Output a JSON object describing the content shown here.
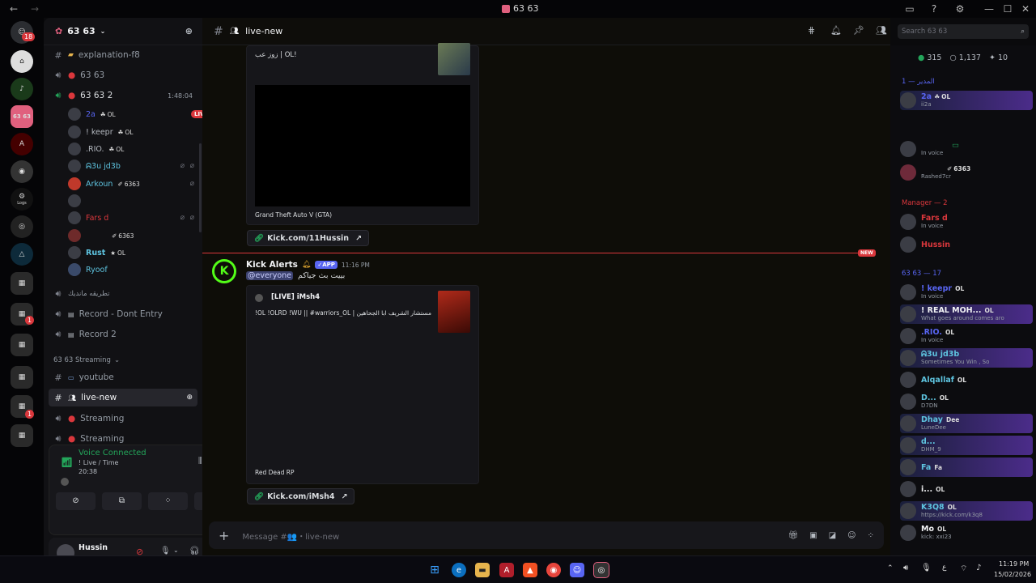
{
  "window": {
    "title": "63 63"
  },
  "rail": {
    "dm_badge": "18",
    "badges": [
      "1",
      "1",
      "1",
      "1"
    ],
    "labels": {
      "logs": "Logs",
      "server_icon": "63 63"
    }
  },
  "server": {
    "name": "63 63"
  },
  "channels": [
    {
      "name": "explanation-f8",
      "type": "text"
    },
    {
      "name": "63 63",
      "type": "voice"
    },
    {
      "name": "63 63 2",
      "type": "voice",
      "timer": "1:48:04"
    }
  ],
  "voice_users": [
    {
      "name": "2a",
      "tag": "OL",
      "live": "LIVE"
    },
    {
      "name": "! keepr",
      "tag": "OL"
    },
    {
      "name": ".RIO.",
      "tag": "OL"
    },
    {
      "name": "ᕱ3u jd3b",
      "tag": ""
    },
    {
      "name": "Arkoun",
      "tag": "6363"
    },
    {
      "name": "",
      "tag": ""
    },
    {
      "name": "Fars d",
      "tag": ""
    },
    {
      "name": "",
      "tag": "6363"
    },
    {
      "name": "Rust",
      "tag": "OL"
    },
    {
      "name": "Ryoof",
      "tag": ""
    }
  ],
  "channels2": [
    {
      "name": "تطريقه مانديك",
      "type": "voice"
    },
    {
      "name": "Record - Dont Entry",
      "type": "voice"
    },
    {
      "name": "Record 2",
      "type": "voice"
    }
  ],
  "category": "63 63 Streaming",
  "channels3": [
    {
      "name": "youtube",
      "type": "text"
    },
    {
      "name": "live-new",
      "type": "text",
      "active": true
    },
    {
      "name": "Streaming",
      "type": "voice"
    },
    {
      "name": "Streaming",
      "type": "voice"
    }
  ],
  "voice_panel": {
    "status": "Voice Connected",
    "channel": "! Live / Time",
    "time": "20:38"
  },
  "user": {
    "name": "Hussin",
    "status": "..."
  },
  "chat": {
    "channel": "live-new",
    "search_placeholder": "Search 63 63",
    "embed1": {
      "desc": "زوز عب | OL!",
      "game": "Grand Theft Auto V (GTA)",
      "link": "Kick.com/11Hussin"
    },
    "new_label": "NEW",
    "message": {
      "author": "Kick Alerts",
      "app": "APP",
      "time": "11:16 PM",
      "mention": "@everyone",
      "text": "بييت بث جياكم"
    },
    "embed2": {
      "title": "[LIVE] iMsh4",
      "desc": "!OL !OLRD !WU || #warriors_OL | مستشار الشريف ابا الجحاهين",
      "game": "Red Dead RP",
      "link": "Kick.com/iMsh4"
    },
    "composer_placeholder": "Message #👥・live-new"
  },
  "members": {
    "stats": {
      "online": "315",
      "members": "1,137",
      "other": "10"
    },
    "groups": [
      {
        "label": "المدير — 1",
        "items": [
          {
            "name": "2a",
            "sub": "ii2a",
            "tag": "OL"
          }
        ]
      },
      {
        "label": "",
        "items": [
          {
            "name": "",
            "sub": "In voice"
          },
          {
            "name": "",
            "sub": "Rashed7cr",
            "tag": "6363"
          }
        ]
      },
      {
        "label": "Manager — 2",
        "items": [
          {
            "name": "Fars d",
            "sub": "In voice"
          },
          {
            "name": "Hussin",
            "sub": ""
          }
        ]
      },
      {
        "label": "63 63 — 17",
        "items": [
          {
            "name": "! keepr",
            "sub": "In voice",
            "tag": "OL"
          },
          {
            "name": "! REAL MOH...",
            "sub": "What goes around comes aro",
            "tag": "OL"
          },
          {
            "name": ".RIO.",
            "sub": "In voice",
            "tag": "OL"
          },
          {
            "name": "ᕱ3u jd3b",
            "sub": "Sometimes You Win , So"
          },
          {
            "name": "Alqallaf",
            "sub": "",
            "tag": "OL"
          },
          {
            "name": "D...",
            "sub": "D7DN",
            "tag": "OL"
          },
          {
            "name": "Dhay",
            "sub": "LuneDee",
            "tag": "Dee"
          },
          {
            "name": "d...",
            "sub": "DHM_9"
          },
          {
            "name": "Fa",
            "sub": "",
            "tag": "Fa"
          },
          {
            "name": "i...",
            "sub": "",
            "tag": "OL"
          },
          {
            "name": "K3Q8",
            "sub": "https://kick.com/k3q8",
            "tag": "OL"
          },
          {
            "name": "Mo",
            "sub": "kick: xxi23",
            "tag": "OL"
          }
        ]
      }
    ]
  },
  "taskbar": {
    "time": "11:19 PM",
    "date": "15/02/2026",
    "lang": "ع"
  },
  "colors": {
    "accent": "#5865f2",
    "live": "#da373c",
    "online": "#23a55a",
    "kick": "#53fc18"
  }
}
